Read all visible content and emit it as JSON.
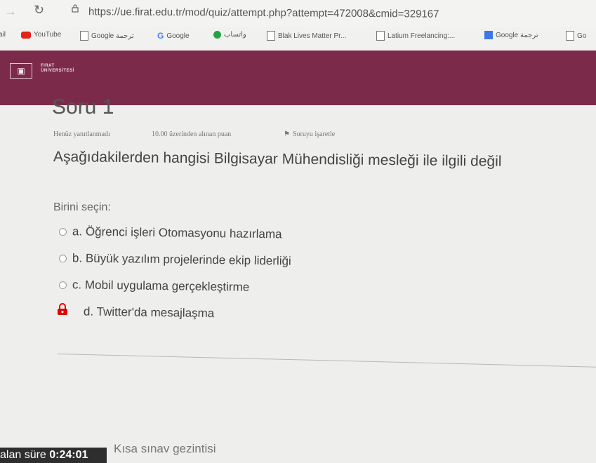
{
  "browser": {
    "url": "https://ue.firat.edu.tr/mod/quiz/attempt.php?attempt=472008&cmid=329167",
    "bookmarks": [
      {
        "label": "ail",
        "icon": "mail-icon"
      },
      {
        "label": "YouTube",
        "icon": "youtube-icon"
      },
      {
        "label": "Google ترجمة",
        "icon": "doc-icon"
      },
      {
        "label": "Google",
        "icon": "google-icon"
      },
      {
        "label": "واتساب",
        "icon": "whatsapp-icon"
      },
      {
        "label": "Blak Lives Matter Pr...",
        "icon": "doc-icon"
      },
      {
        "label": "Latium Freelancing:...",
        "icon": "doc-icon"
      },
      {
        "label": "Google ترجمة",
        "icon": "translate-icon"
      },
      {
        "label": "Go",
        "icon": "doc-icon"
      }
    ]
  },
  "header": {
    "logo_text_line1": "FIRAT",
    "logo_text_line2": "ÜNİVERSİTESİ",
    "brand_color": "#7b2b49"
  },
  "question": {
    "title": "Soru 1",
    "status": "Henüz yanıtlanmadı",
    "points": "10.00 üzerinden alınan puan",
    "flag_label": "Soruyu işaretle",
    "text": "Aşağıdakilerden hangisi Bilgisayar Mühendisliği mesleği ile ilgili değil",
    "prompt": "Birini seçin:",
    "options": [
      {
        "label": "a. Öğrenci işleri Otomasyonu hazırlama",
        "selected": false
      },
      {
        "label": "b. Büyük yazılım projelerinde ekip liderliği",
        "selected": false
      },
      {
        "label": "c. Mobil uygulama gerçekleştirme",
        "selected": false
      },
      {
        "label": "d. Twitter'da mesajlaşma",
        "selected": true
      }
    ],
    "selected_mark_color": "#e00000"
  },
  "footer": {
    "timer_label": "alan süre",
    "timer_value": "0:24:01",
    "quiz_nav": "Kısa sınav gezintisi"
  }
}
